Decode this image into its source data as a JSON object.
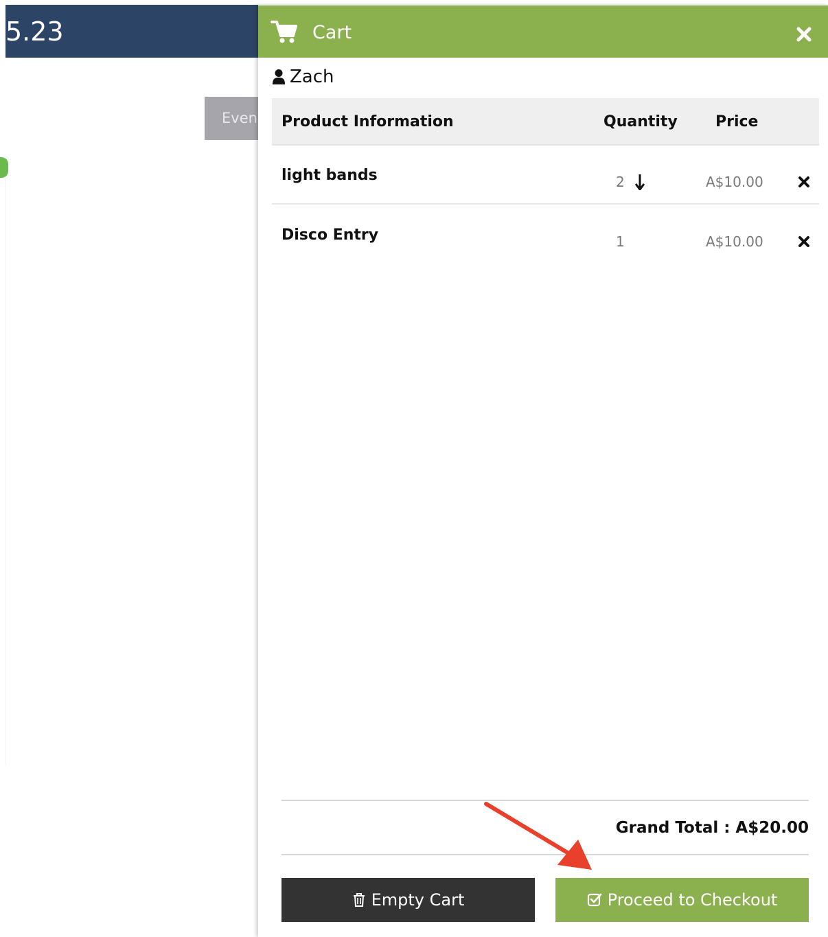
{
  "background": {
    "amount_fragment": "5.23",
    "tab_fragment": "Even"
  },
  "cart": {
    "title": "Cart",
    "customer_name": "Zach",
    "columns": {
      "product": "Product Information",
      "quantity": "Quantity",
      "price": "Price"
    },
    "items": [
      {
        "name": "light bands",
        "quantity": "2",
        "price": "A$10.00"
      },
      {
        "name": "Disco Entry",
        "quantity": "1",
        "price": "A$10.00"
      }
    ],
    "grand_total_label": "Grand Total : A$20.00",
    "empty_cart_label": "Empty Cart",
    "checkout_label": "Proceed to Checkout"
  },
  "icons": {
    "cart": "shopping-cart-icon",
    "close": "close-icon",
    "user": "user-icon",
    "quantity": "arrow-down-icon",
    "remove": "remove-x-icon",
    "trash": "trash-icon",
    "check": "check-square-icon"
  },
  "colors": {
    "header_green": "#8bb14f",
    "topbar_navy": "#2c4566",
    "empty_button": "#333333",
    "annotation_red": "#e8402a"
  }
}
